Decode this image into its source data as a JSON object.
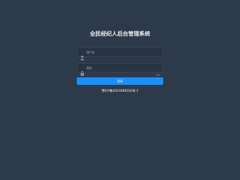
{
  "page": {
    "title": "全民经纪人后台管理系统"
  },
  "form": {
    "username": {
      "placeholder": "用户名",
      "value": "",
      "icon": "user-icon"
    },
    "password": {
      "placeholder": "密码",
      "value": "",
      "icon": "lock-icon",
      "toggle_icon": "eye-closed-icon"
    },
    "login_label": "登录"
  },
  "footer": {
    "icp": "鄂ICP备2023006316号-1"
  },
  "colors": {
    "background": "#2d3a4b",
    "input_background": "#283443",
    "accent": "#1890ff",
    "icon": "#889aa4"
  }
}
